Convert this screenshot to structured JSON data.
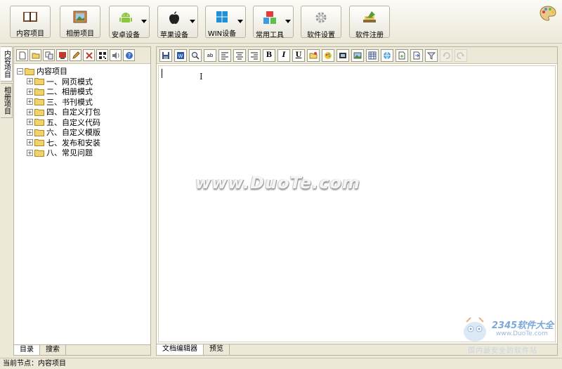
{
  "toolbar": {
    "buttons": [
      {
        "label": "内容项目",
        "icon": "book-icon"
      },
      {
        "label": "相册项目",
        "icon": "photo-icon"
      },
      {
        "label": "安卓设备",
        "icon": "android-icon"
      },
      {
        "label": "苹果设备",
        "icon": "apple-icon"
      },
      {
        "label": "WIN设备",
        "icon": "windows-icon"
      },
      {
        "label": "常用工具",
        "icon": "blocks-icon"
      },
      {
        "label": "软件设置",
        "icon": "gear-icon"
      },
      {
        "label": "软件注册",
        "icon": "register-icon"
      }
    ]
  },
  "side_tabs": [
    "内容项目",
    "相册项目"
  ],
  "tree": {
    "root": "内容项目",
    "children": [
      "一、网页模式",
      "二、相册模式",
      "三、书刊模式",
      "四、自定义打包",
      "五、自定义代码",
      "六、自定义模版",
      "七、发布和安装",
      "八、常见问题"
    ]
  },
  "left_tabs": [
    "目录",
    "搜索"
  ],
  "editor_toolbar": {
    "bold": "B",
    "italic": "I",
    "underline": "U",
    "abc": "ab"
  },
  "editor": {
    "watermark": "www.DuoTe.com"
  },
  "editor_tabs": [
    "文档编辑器",
    "预览"
  ],
  "corner_logo": {
    "brand": "2345软件大全",
    "url": "www.DuoTe.com",
    "slogan": "国内最安全的软件站"
  },
  "status": {
    "text": "当前节点：内容项目"
  },
  "colors": {
    "chrome": "#ece9d8",
    "border": "#b9b4a0",
    "folder": "#f2d36b"
  }
}
